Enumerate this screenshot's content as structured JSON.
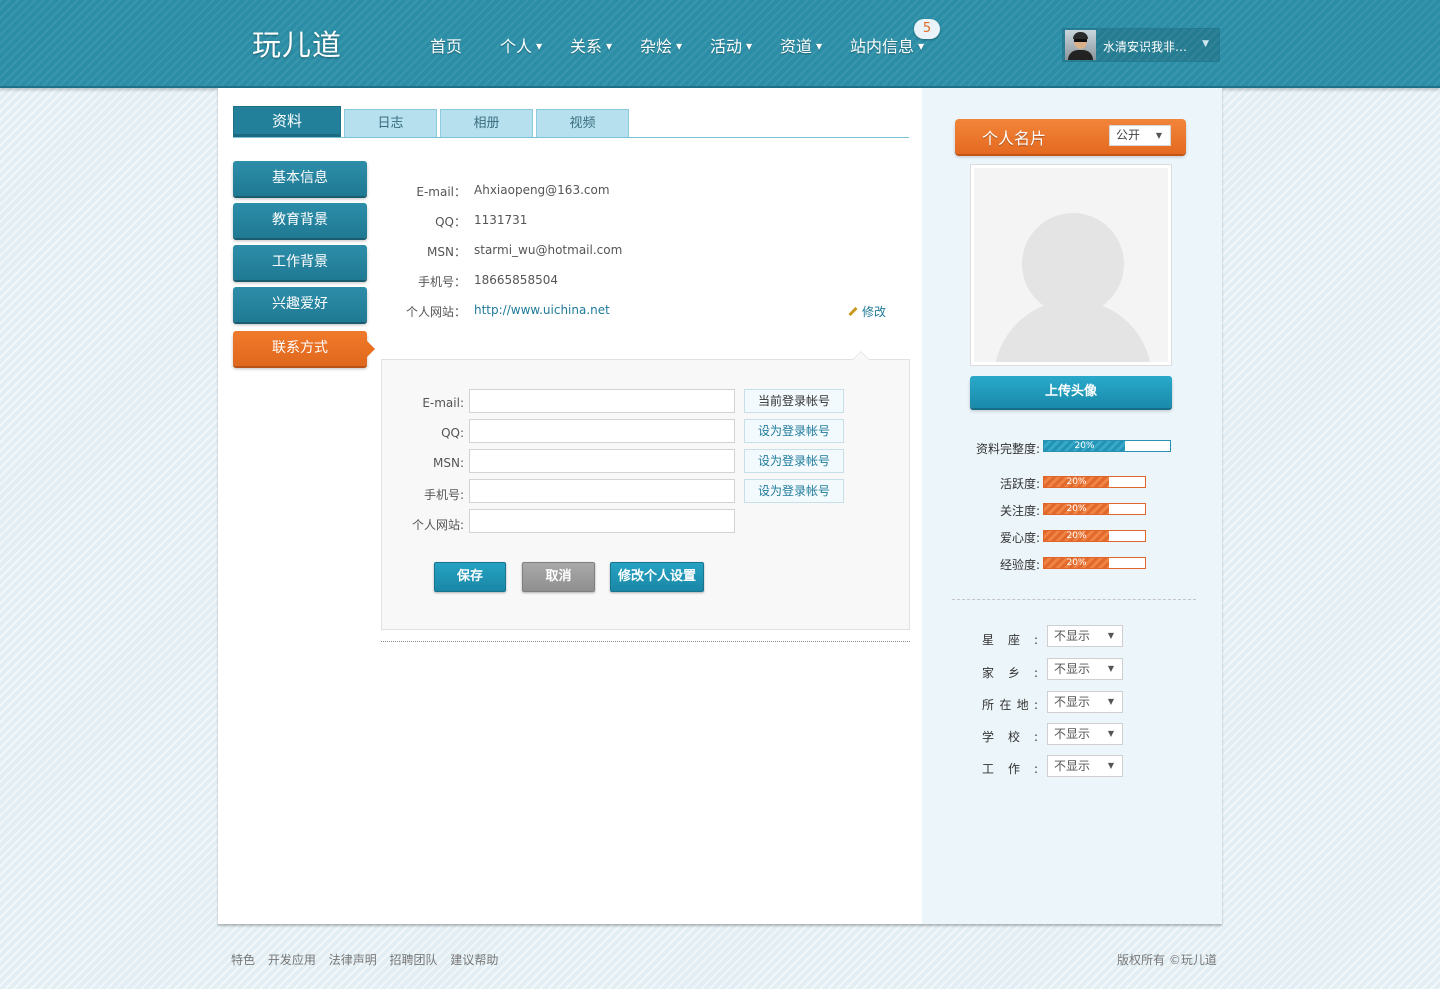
{
  "header": {
    "logo": "玩儿道",
    "nav": [
      {
        "label": "首页",
        "dropdown": false
      },
      {
        "label": "个人",
        "dropdown": true
      },
      {
        "label": "关系",
        "dropdown": true
      },
      {
        "label": "杂烩",
        "dropdown": true
      },
      {
        "label": "活动",
        "dropdown": true
      },
      {
        "label": "资道",
        "dropdown": true
      },
      {
        "label": "站内信息",
        "dropdown": true
      }
    ],
    "message_count": "5",
    "user_name": "水清安识我非…"
  },
  "tabs": [
    {
      "label": "资料",
      "active": true
    },
    {
      "label": "日志",
      "active": false
    },
    {
      "label": "相册",
      "active": false
    },
    {
      "label": "视频",
      "active": false
    }
  ],
  "side_menu": [
    {
      "label": "基本信息",
      "active": false
    },
    {
      "label": "教育背景",
      "active": false
    },
    {
      "label": "工作背景",
      "active": false
    },
    {
      "label": "兴趣爱好",
      "active": false
    },
    {
      "label": "联系方式",
      "active": true
    }
  ],
  "contact": {
    "rows": [
      {
        "label": "E-mail：",
        "value": "Ahxiaopeng@163.com",
        "is_link": false
      },
      {
        "label": "QQ：",
        "value": "1131731",
        "is_link": false
      },
      {
        "label": "MSN：",
        "value": "starmi_wu@hotmail.com",
        "is_link": false
      },
      {
        "label": "手机号：",
        "value": "18665858504",
        "is_link": false
      },
      {
        "label": "个人网站：",
        "value": "http://www.uichina.net",
        "is_link": true
      }
    ],
    "edit_label": "修改"
  },
  "form": {
    "fields": [
      {
        "label": "E-mail:",
        "value": "",
        "tag": "当前登录帐号",
        "tag_current": true
      },
      {
        "label": "QQ:",
        "value": "",
        "tag": "设为登录帐号",
        "tag_current": false
      },
      {
        "label": "MSN:",
        "value": "",
        "tag": "设为登录帐号",
        "tag_current": false
      },
      {
        "label": "手机号:",
        "value": "",
        "tag": "设为登录帐号",
        "tag_current": false
      },
      {
        "label": "个人网站:",
        "value": "",
        "tag": "",
        "tag_current": false
      }
    ],
    "save": "保存",
    "cancel": "取消",
    "settings": "修改个人设置"
  },
  "card": {
    "title": "个人名片",
    "visibility": "公开",
    "upload": "上传头像",
    "completeness": {
      "label": "资料完整度:",
      "value": 20,
      "text": "20%"
    },
    "stats": [
      {
        "label": "活跃度:",
        "value": 20,
        "text": "20%"
      },
      {
        "label": "关注度:",
        "value": 20,
        "text": "20%"
      },
      {
        "label": "爱心度:",
        "value": 20,
        "text": "20%"
      },
      {
        "label": "经验度:",
        "value": 20,
        "text": "20%"
      }
    ],
    "privacy": [
      {
        "label": "星座:",
        "value": "不显示"
      },
      {
        "label": "家乡:",
        "value": "不显示"
      },
      {
        "label": "所在地:",
        "value": "不显示"
      },
      {
        "label": "学校:",
        "value": "不显示"
      },
      {
        "label": "工作:",
        "value": "不显示"
      }
    ]
  },
  "colors": {
    "header": "#2b8ea6",
    "accent_orange": "#e8701f",
    "accent_blue": "#22809b"
  },
  "footer": {
    "links": [
      "特色",
      "开发应用",
      "法律声明",
      "招聘团队",
      "建议帮助"
    ],
    "copyright": "版权所有 ©玩儿道"
  }
}
